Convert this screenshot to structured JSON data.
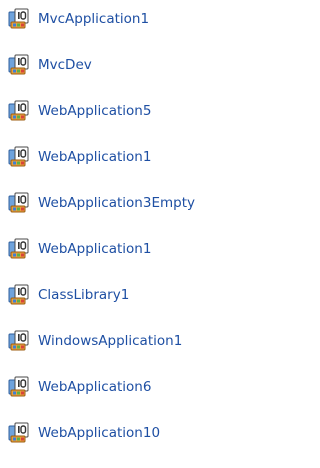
{
  "icon": "vb-project-icon",
  "colors": {
    "link": "#1e4fa3"
  },
  "projects": [
    {
      "label": "MvcApplication1"
    },
    {
      "label": "MvcDev"
    },
    {
      "label": "WebApplication5"
    },
    {
      "label": "WebApplication1"
    },
    {
      "label": "WebApplication3Empty"
    },
    {
      "label": "WebApplication1"
    },
    {
      "label": "ClassLibrary1"
    },
    {
      "label": "WindowsApplication1"
    },
    {
      "label": "WebApplication6"
    },
    {
      "label": "WebApplication10"
    }
  ]
}
